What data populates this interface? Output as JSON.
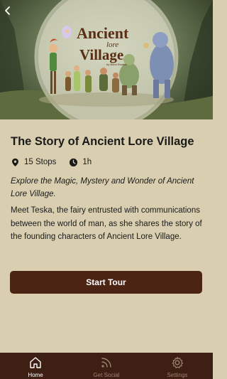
{
  "hero": {
    "logo_line1": "Ancient",
    "logo_line2": "lore",
    "logo_line3": "Village",
    "logo_sub": "by Bond Studios"
  },
  "nav": {
    "back_icon": "chevron-left-icon"
  },
  "tour": {
    "title": "The Story of Ancient Lore Village",
    "stops": "15 Stops",
    "duration": "1h",
    "tagline": "Explore the Magic, Mystery and Wonder of Ancient Lore Village.",
    "description": "Meet Teska, the fairy entrusted with communications between the world of man, as she shares the story of the founding characters of Ancient Lore Village."
  },
  "actions": {
    "start_label": "Start Tour"
  },
  "tabbar": {
    "tabs": [
      {
        "label": "Home",
        "icon": "home-icon",
        "active": true
      },
      {
        "label": "Get Social",
        "icon": "rss-icon",
        "active": false
      },
      {
        "label": "Settings",
        "icon": "gear-icon",
        "active": false
      }
    ]
  },
  "colors": {
    "background": "#d9cfb0",
    "button": "#4b2414",
    "tabbar": "#3d1f14",
    "tab_active": "#ffffff",
    "tab_inactive": "#9c8270"
  }
}
